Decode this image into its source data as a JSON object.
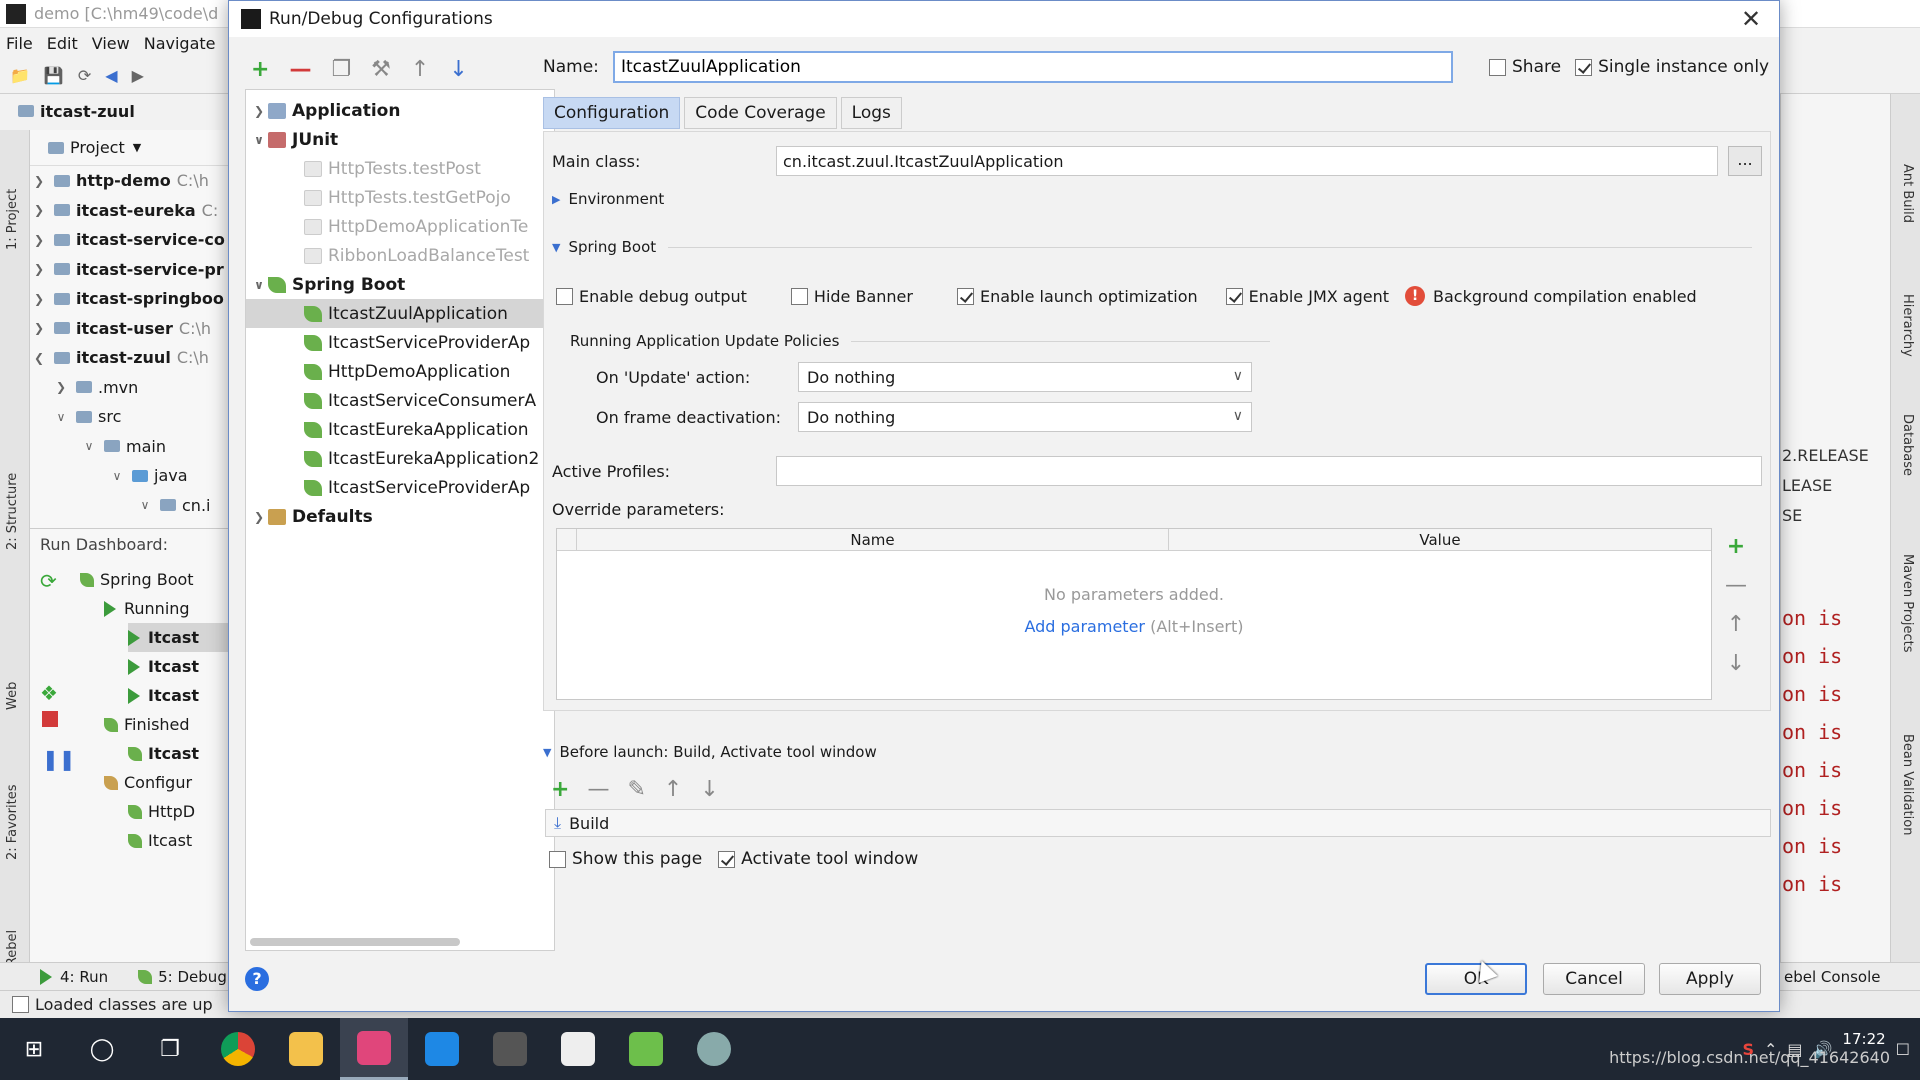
{
  "ide": {
    "title": "demo [C:\\hm49\\code\\d",
    "menu": [
      "File",
      "Edit",
      "View",
      "Navigate"
    ],
    "breadcrumb": "itcast-zuul",
    "project_header": "Project",
    "project_items": [
      {
        "name": "http-demo",
        "path": "C:\\h"
      },
      {
        "name": "itcast-eureka",
        "path": "C:"
      },
      {
        "name": "itcast-service-co",
        "path": ""
      },
      {
        "name": "itcast-service-pr",
        "path": ""
      },
      {
        "name": "itcast-springboo",
        "path": ""
      },
      {
        "name": "itcast-user",
        "path": "C:\\h"
      },
      {
        "name": "itcast-zuul",
        "path": "C:\\h"
      },
      {
        "name": ".mvn",
        "path": ""
      },
      {
        "name": "src",
        "path": ""
      },
      {
        "name": "main",
        "path": ""
      },
      {
        "name": "java",
        "path": ""
      },
      {
        "name": "cn.i",
        "path": ""
      }
    ],
    "run_dashboard": {
      "title": "Run Dashboard:",
      "items": [
        "Spring Boot",
        "Running",
        "Itcast",
        "Itcast",
        "Itcast",
        "Finished",
        "Itcast",
        "Configur",
        "HttpD",
        "Itcast"
      ]
    },
    "left_strip_labels": [
      "1: Project",
      "2: Structure",
      "Web",
      "2: Favorites",
      "JRebel"
    ],
    "right_strip_labels": [
      "Ant Build",
      "Hierarchy",
      "Database",
      "Maven Projects",
      "Bean Validation"
    ],
    "release_lines": [
      "2.RELEASE",
      "LEASE",
      "SE"
    ],
    "console_lines": [
      "on is",
      "on is",
      "on is",
      "on is",
      "on is",
      "on is",
      "on is",
      "on is"
    ],
    "bottom_tabs": [
      "4: Run",
      "5: Debug",
      "ebel Console"
    ],
    "status_text": "Loaded classes are up"
  },
  "dialog": {
    "title": "Run/Debug Configurations",
    "tree": [
      {
        "label": "Application",
        "style": "bold",
        "icon": "app",
        "indent": 0,
        "arrow": "right"
      },
      {
        "label": "JUnit",
        "style": "bold",
        "icon": "junit",
        "indent": 0,
        "arrow": "down"
      },
      {
        "label": "HttpTests.testPost",
        "style": "grey",
        "icon": "test",
        "indent": 1
      },
      {
        "label": "HttpTests.testGetPojo",
        "style": "grey",
        "icon": "test",
        "indent": 1
      },
      {
        "label": "HttpDemoApplicationTe",
        "style": "grey",
        "icon": "test",
        "indent": 1
      },
      {
        "label": "RibbonLoadBalanceTest",
        "style": "grey",
        "icon": "test",
        "indent": 1
      },
      {
        "label": "Spring Boot",
        "style": "bold",
        "icon": "spring",
        "indent": 0,
        "arrow": "down"
      },
      {
        "label": "ItcastZuulApplication",
        "style": "selected",
        "icon": "spring",
        "indent": 1
      },
      {
        "label": "ItcastServiceProviderAp",
        "style": "",
        "icon": "spring",
        "indent": 1
      },
      {
        "label": "HttpDemoApplication",
        "style": "",
        "icon": "spring",
        "indent": 1
      },
      {
        "label": "ItcastServiceConsumerA",
        "style": "",
        "icon": "spring",
        "indent": 1
      },
      {
        "label": "ItcastEurekaApplication",
        "style": "",
        "icon": "spring",
        "indent": 1
      },
      {
        "label": "ItcastEurekaApplication2",
        "style": "",
        "icon": "spring",
        "indent": 1
      },
      {
        "label": "ItcastServiceProviderAp",
        "style": "",
        "icon": "spring",
        "indent": 1
      },
      {
        "label": "Defaults",
        "style": "bold",
        "icon": "def",
        "indent": 0,
        "arrow": "right"
      }
    ],
    "name_label": "Name:",
    "name_value": "ItcastZuulApplication",
    "share_label": "Share",
    "single_instance_label": "Single instance only",
    "tabs": [
      "Configuration",
      "Code Coverage",
      "Logs"
    ],
    "main_class_label": "Main class:",
    "main_class_value": "cn.itcast.zuul.ItcastZuulApplication",
    "ellipsis": "...",
    "environment_label": "Environment",
    "spring_boot_label": "Spring Boot",
    "checkboxes": {
      "debug": "Enable debug output",
      "hide_banner": "Hide Banner",
      "launch_opt": "Enable launch optimization",
      "jmx": "Enable JMX agent",
      "bg_compile": "Background compilation enabled"
    },
    "update_policies_label": "Running Application Update Policies",
    "on_update_label": "On 'Update' action:",
    "on_update_value": "Do nothing",
    "on_frame_label": "On frame deactivation:",
    "on_frame_value": "Do nothing",
    "active_profiles_label": "Active Profiles:",
    "override_label": "Override parameters:",
    "param_columns": [
      "Name",
      "Value"
    ],
    "no_params": "No parameters added.",
    "add_param": "Add parameter",
    "add_param_hint": "(Alt+Insert)",
    "before_launch": "Before launch: Build, Activate tool window",
    "build_item": "Build",
    "show_page_label": "Show this page",
    "activate_tool_label": "Activate tool window",
    "ok": "OK",
    "cancel": "Cancel",
    "apply": "Apply",
    "help": "?"
  },
  "taskbar": {
    "time": "17:22",
    "watermark": "https://blog.csdn.net/qq_41642640"
  },
  "colors": {
    "accent": "#3b78d8",
    "tab_active": "#c7d9f3",
    "link": "#2a6ee0",
    "spring": "#6ab04c",
    "warning": "#e24d3a"
  }
}
